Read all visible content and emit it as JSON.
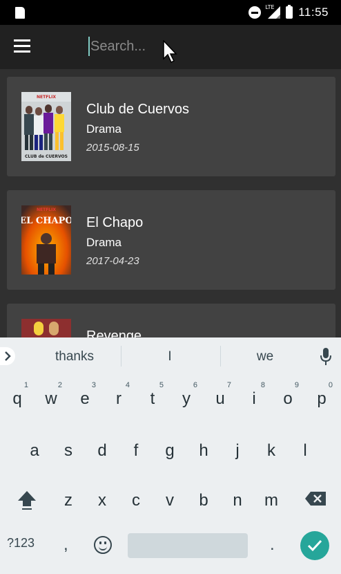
{
  "status_bar": {
    "network_label": "LTE",
    "time": "11:55"
  },
  "toolbar": {
    "search_placeholder": "Search..."
  },
  "shows": [
    {
      "title": "Club de Cuervos",
      "genre": "Drama",
      "date": "2015-08-15",
      "poster_text": "CLUB de CUERVOS",
      "poster_brand": "NETFLIX"
    },
    {
      "title": "El Chapo",
      "genre": "Drama",
      "date": "2017-04-23",
      "poster_text": "EL CHAPO",
      "poster_brand": "NETFLIX"
    },
    {
      "title": "Revenge",
      "genre": "",
      "date": ""
    }
  ],
  "keyboard": {
    "suggestions": [
      "thanks",
      "I",
      "we"
    ],
    "row1": [
      {
        "ch": "q",
        "hint": "1"
      },
      {
        "ch": "w",
        "hint": "2"
      },
      {
        "ch": "e",
        "hint": "3"
      },
      {
        "ch": "r",
        "hint": "4"
      },
      {
        "ch": "t",
        "hint": "5"
      },
      {
        "ch": "y",
        "hint": "6"
      },
      {
        "ch": "u",
        "hint": "7"
      },
      {
        "ch": "i",
        "hint": "8"
      },
      {
        "ch": "o",
        "hint": "9"
      },
      {
        "ch": "p",
        "hint": "0"
      }
    ],
    "row2": [
      "a",
      "s",
      "d",
      "f",
      "g",
      "h",
      "j",
      "k",
      "l"
    ],
    "row3": [
      "z",
      "x",
      "c",
      "v",
      "b",
      "n",
      "m"
    ],
    "symbols_label": "?123",
    "comma_label": ",",
    "period_label": "."
  },
  "colors": {
    "accent": "#26a69a",
    "background": "#303030",
    "card": "#424242",
    "toolbar": "#212121"
  }
}
